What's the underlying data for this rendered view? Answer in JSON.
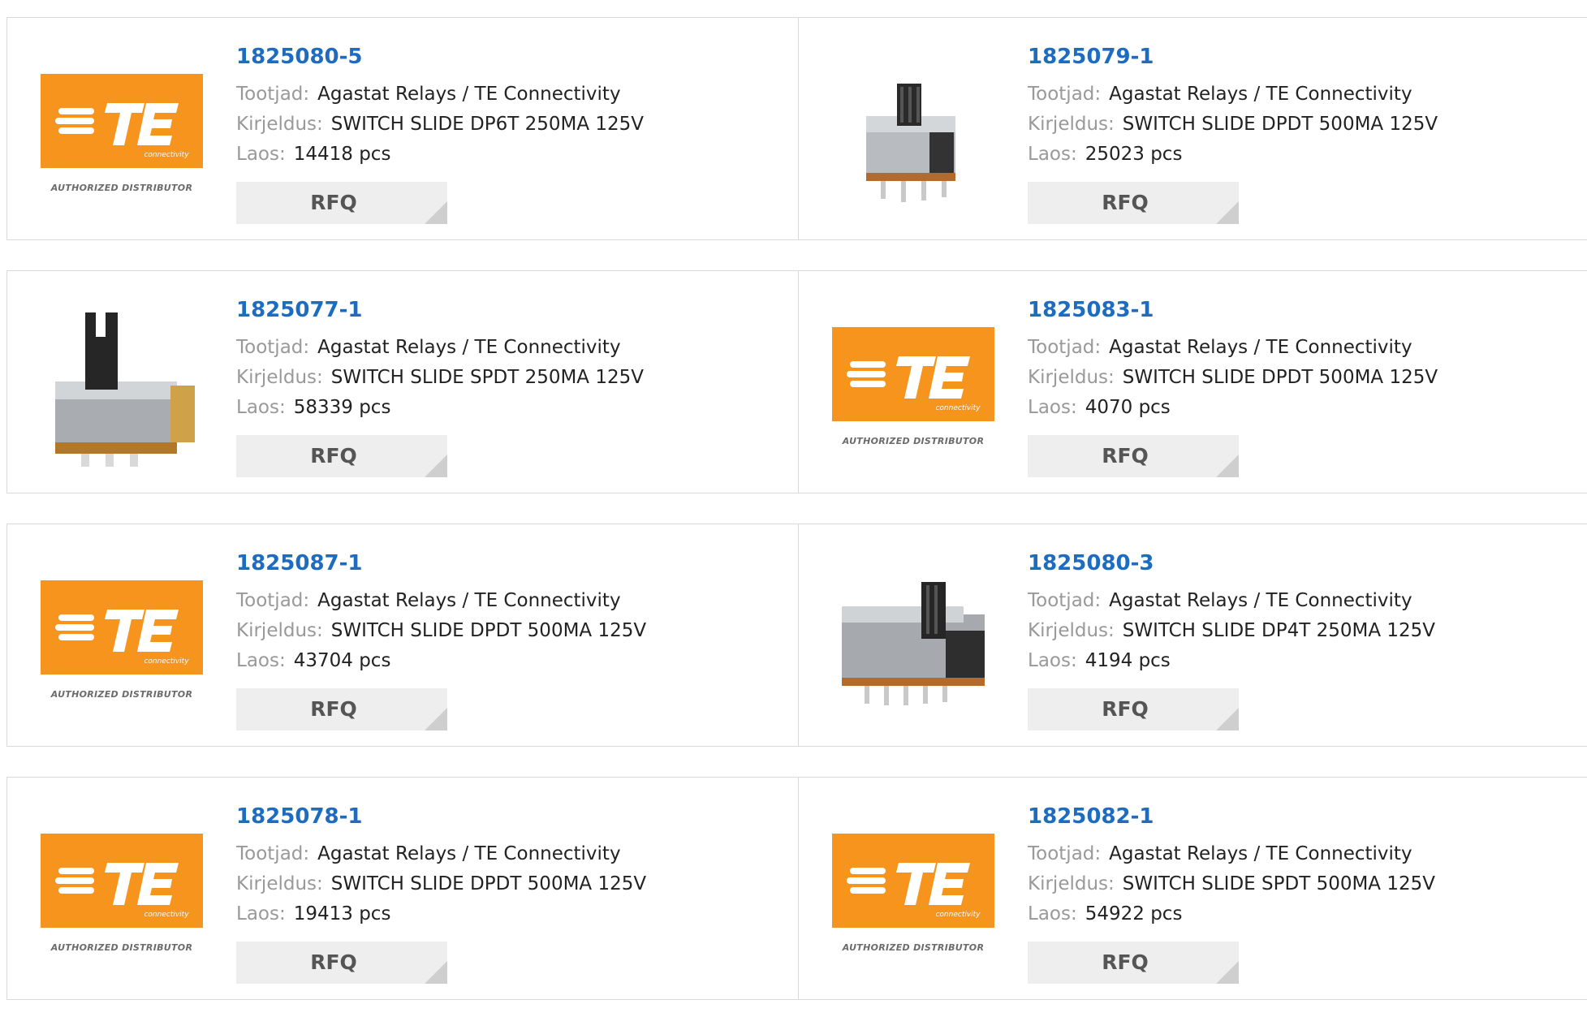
{
  "labels": {
    "manufacturer": "Tootjad:",
    "description": "Kirjeldus:",
    "stock": "Laos:",
    "rfq": "RFQ"
  },
  "logo": {
    "brand": "TE",
    "sub": "connectivity",
    "caption": "AUTHORIZED DISTRIBUTOR",
    "orange": "#f7941d"
  },
  "products": [
    {
      "part": "1825080-5",
      "manufacturer": "Agastat Relays / TE Connectivity",
      "description": "SWITCH SLIDE DP6T 250MA 125V",
      "stock": "14418 pcs",
      "image": "te-logo"
    },
    {
      "part": "1825079-1",
      "manufacturer": "Agastat Relays / TE Connectivity",
      "description": "SWITCH SLIDE DPDT 500MA 125V",
      "stock": "25023 pcs",
      "image": "slide-switch-vertical-photo"
    },
    {
      "part": "1825077-1",
      "manufacturer": "Agastat Relays / TE Connectivity",
      "description": "SWITCH SLIDE SPDT 250MA 125V",
      "stock": "58339 pcs",
      "image": "slide-switch-large-photo"
    },
    {
      "part": "1825083-1",
      "manufacturer": "Agastat Relays / TE Connectivity",
      "description": "SWITCH SLIDE DPDT 500MA 125V",
      "stock": "4070 pcs",
      "image": "te-logo"
    },
    {
      "part": "1825087-1",
      "manufacturer": "Agastat Relays / TE Connectivity",
      "description": "SWITCH SLIDE DPDT 500MA 125V",
      "stock": "43704 pcs",
      "image": "te-logo"
    },
    {
      "part": "1825080-3",
      "manufacturer": "Agastat Relays / TE Connectivity",
      "description": "SWITCH SLIDE DP4T 250MA 125V",
      "stock": "4194 pcs",
      "image": "slide-switch-long-photo"
    },
    {
      "part": "1825078-1",
      "manufacturer": "Agastat Relays / TE Connectivity",
      "description": "SWITCH SLIDE DPDT 500MA 125V",
      "stock": "19413 pcs",
      "image": "te-logo"
    },
    {
      "part": "1825082-1",
      "manufacturer": "Agastat Relays / TE Connectivity",
      "description": "SWITCH SLIDE SPDT 500MA 125V",
      "stock": "54922 pcs",
      "image": "te-logo"
    }
  ]
}
